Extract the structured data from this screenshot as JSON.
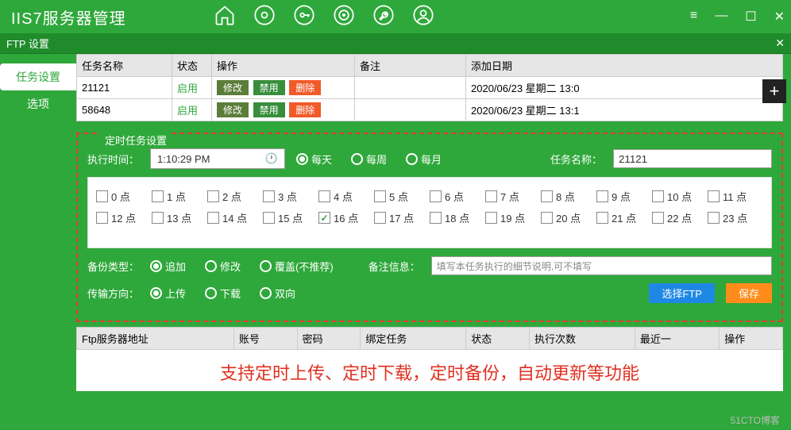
{
  "app_title": "IIS7服务器管理",
  "panel_title": "FTP 设置",
  "side_tabs": {
    "task_settings": "任务设置",
    "options": "选项"
  },
  "task_table": {
    "headers": {
      "name": "任务名称",
      "status": "状态",
      "action": "操作",
      "remark": "备注",
      "date": "添加日期"
    },
    "status_enabled": "启用",
    "btn_edit": "修改",
    "btn_disable": "禁用",
    "btn_delete": "删除",
    "rows": [
      {
        "name": "21121",
        "date": "2020/06/23 星期二 13:0"
      },
      {
        "name": "58648",
        "date": "2020/06/23 星期二 13:1"
      }
    ]
  },
  "sched": {
    "legend": "定时任务设置",
    "exec_time_label": "执行时间：",
    "exec_time_value": "1:10:29 PM",
    "freq": {
      "daily": "每天",
      "weekly": "每周",
      "monthly": "每月"
    },
    "task_name_label": "任务名称：",
    "task_name_value": "21121",
    "hours": [
      "0 点",
      "1 点",
      "2 点",
      "3 点",
      "4 点",
      "5 点",
      "6 点",
      "7 点",
      "8 点",
      "9 点",
      "10 点",
      "11 点",
      "12 点",
      "13 点",
      "14 点",
      "15 点",
      "16 点",
      "17 点",
      "18 点",
      "19 点",
      "20 点",
      "21 点",
      "22 点",
      "23 点"
    ],
    "checked_hour_index": 16,
    "backup_type_label": "备份类型：",
    "backup_type": {
      "append": "追加",
      "modify": "修改",
      "overwrite": "覆盖(不推荐)"
    },
    "remark_label": "备注信息：",
    "remark_placeholder": "填写本任务执行的细节说明,可不填写",
    "dir_label": "传输方向：",
    "dir": {
      "upload": "上传",
      "download": "下载",
      "both": "双向"
    },
    "btn_select_ftp": "选择FTP",
    "btn_save": "保存"
  },
  "ftp_table": {
    "headers": {
      "addr": "Ftp服务器地址",
      "account": "账号",
      "password": "密码",
      "bind": "绑定任务",
      "status": "状态",
      "count": "执行次数",
      "recent": "最近一",
      "action": "操作"
    }
  },
  "bottom_note": "支持定时上传、定时下载，定时备份，自动更新等功能",
  "watermark": "51CTO博客"
}
